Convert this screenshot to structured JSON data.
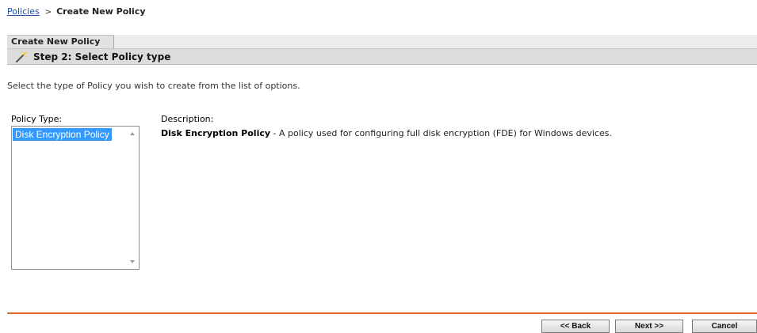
{
  "breadcrumb": {
    "link": "Policies",
    "separator": ">",
    "current": "Create New Policy"
  },
  "tab": {
    "label": "Create New Policy"
  },
  "step": {
    "title": "Step 2: Select Policy type",
    "icon": "wizard-wand-icon"
  },
  "intro": "Select the type of Policy you wish to create from the list of options.",
  "policy_type": {
    "label": "Policy Type:",
    "options": [
      "Disk Encryption Policy"
    ],
    "selected": "Disk Encryption Policy"
  },
  "description": {
    "label": "Description:",
    "name": "Disk Encryption Policy",
    "text": " - A policy used for configuring full disk encryption (FDE) for Windows devices."
  },
  "buttons": {
    "back": "<< Back",
    "next": "Next >>",
    "cancel": "Cancel"
  },
  "colors": {
    "link": "#1f4fa8",
    "selection": "#3399ff",
    "divider": "#e3692a"
  }
}
